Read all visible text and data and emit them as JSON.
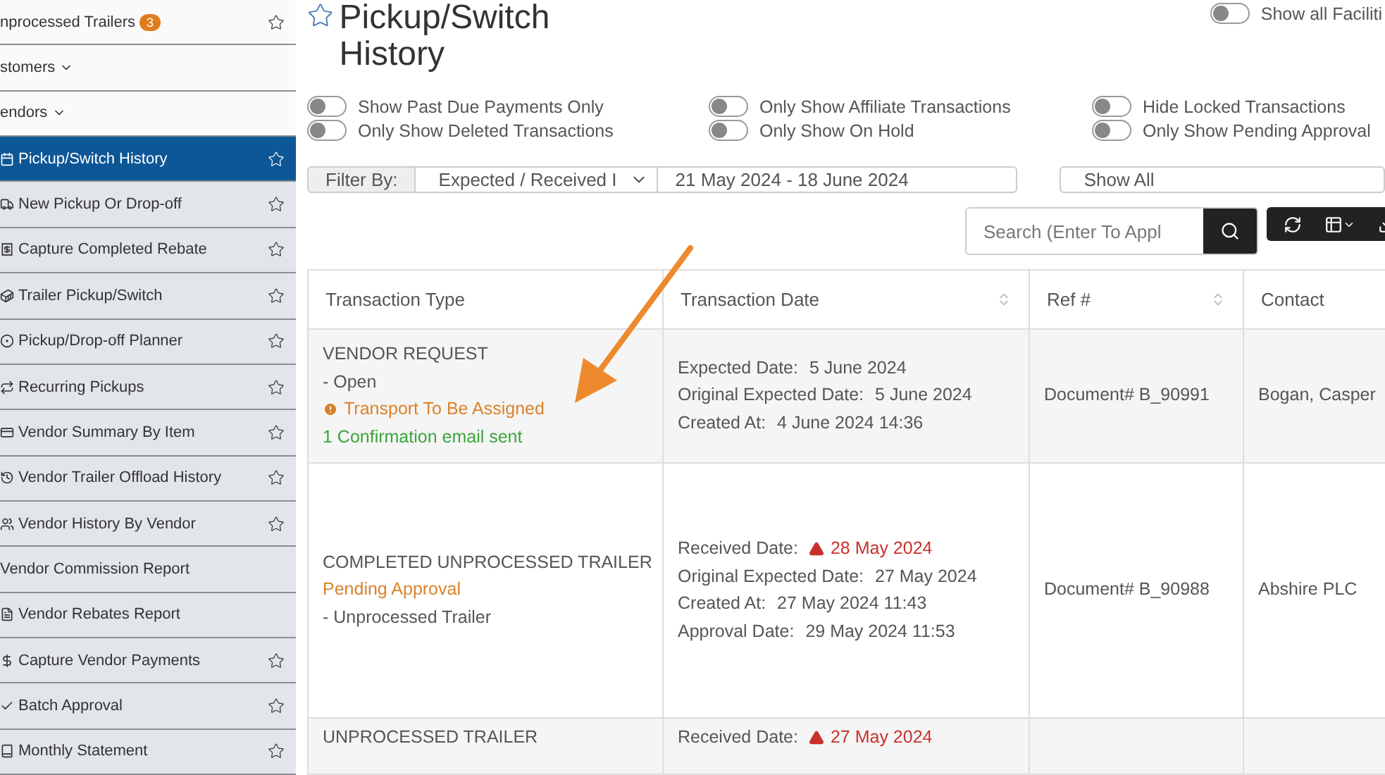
{
  "sidebar": {
    "items": [
      {
        "label": "nprocessed Trailers",
        "badge": "3",
        "kind": "link",
        "starred": true,
        "selected": false
      },
      {
        "label": "stomers",
        "kind": "dropdown",
        "starred": false,
        "selected": false
      },
      {
        "label": "endors",
        "kind": "dropdown",
        "starred": false,
        "selected": false
      },
      {
        "label": "Pickup/Switch History",
        "kind": "subitem",
        "starred": true,
        "selected": true
      },
      {
        "label": "New Pickup Or Drop-off",
        "kind": "subitem",
        "starred": true,
        "selected": false
      },
      {
        "label": "Capture Completed Rebate",
        "kind": "subitem",
        "starred": true,
        "selected": false
      },
      {
        "label": "Trailer Pickup/Switch",
        "kind": "subitem",
        "starred": true,
        "selected": false
      },
      {
        "label": "Pickup/Drop-off Planner",
        "kind": "subitem",
        "starred": true,
        "selected": false
      },
      {
        "label": "Recurring Pickups",
        "kind": "subitem",
        "starred": true,
        "selected": false
      },
      {
        "label": "Vendor Summary By Item",
        "kind": "subitem",
        "starred": true,
        "selected": false
      },
      {
        "label": "Vendor Trailer Offload History",
        "kind": "subitem",
        "starred": true,
        "selected": false
      },
      {
        "label": "Vendor History By Vendor",
        "kind": "subitem",
        "starred": true,
        "selected": false
      },
      {
        "label": "Vendor Commission Report",
        "kind": "subitem",
        "starred": false,
        "selected": false
      },
      {
        "label": "Vendor Rebates Report",
        "kind": "subitem",
        "starred": false,
        "selected": false
      },
      {
        "label": "Capture Vendor Payments",
        "kind": "subitem",
        "starred": true,
        "selected": false
      },
      {
        "label": "Batch Approval",
        "kind": "subitem",
        "starred": true,
        "selected": false
      },
      {
        "label": "Monthly Statement",
        "kind": "subitem",
        "starred": true,
        "selected": false
      }
    ]
  },
  "page": {
    "title": "Pickup/Switch History",
    "starred": false
  },
  "facility_toggle": {
    "label": "Show all Faciliti",
    "on": false
  },
  "toggles": [
    {
      "label": "Show Past Due Payments Only",
      "on": false
    },
    {
      "label": "Only Show Deleted Transactions",
      "on": false
    },
    {
      "label": "Only Show Affiliate Transactions",
      "on": false
    },
    {
      "label": "Only Show On Hold",
      "on": false
    },
    {
      "label": "Hide Locked Transactions",
      "on": false
    },
    {
      "label": "Only Show Pending Approval",
      "on": false
    }
  ],
  "filter": {
    "label": "Filter By:",
    "date_type": "Expected / Received I",
    "date_range": "21 May 2024 - 18 June 2024",
    "status": "Show All"
  },
  "search": {
    "placeholder": "Search (Enter To Appl"
  },
  "table": {
    "columns": [
      {
        "label": "Transaction Type",
        "sortable": false
      },
      {
        "label": "Transaction Date",
        "sortable": true
      },
      {
        "label": "Ref #",
        "sortable": true
      },
      {
        "label": "Contact",
        "sortable": false
      }
    ],
    "rows": [
      {
        "type_lines": [
          {
            "kind": "plain",
            "text": "VENDOR REQUEST"
          },
          {
            "kind": "plain",
            "text": "- Open"
          },
          {
            "kind": "warning",
            "text": "Transport To Be Assigned"
          },
          {
            "kind": "success",
            "text": "1 Confirmation email sent"
          }
        ],
        "date_lines": [
          {
            "label": "Expected Date:",
            "value": "5 June 2024",
            "alert": false
          },
          {
            "label": "Original Expected Date:",
            "value": "5 June 2024",
            "alert": false
          },
          {
            "label": "Created At:",
            "value": "4 June 2024 14:36",
            "alert": false
          }
        ],
        "ref": "Document# B_90991",
        "contact": "Bogan, Casper"
      },
      {
        "type_lines": [
          {
            "kind": "plain",
            "text": "COMPLETED UNPROCESSED TRAILER"
          },
          {
            "kind": "pending",
            "text": "Pending Approval"
          },
          {
            "kind": "plain",
            "text": "- Unprocessed Trailer"
          }
        ],
        "date_lines": [
          {
            "label": "Received Date:",
            "value": "28 May 2024",
            "alert": true
          },
          {
            "label": "Original Expected Date:",
            "value": "27 May 2024",
            "alert": false
          },
          {
            "label": "Created At:",
            "value": "27 May 2024 11:43",
            "alert": false
          },
          {
            "label": "Approval Date:",
            "value": "29 May 2024 11:53",
            "alert": false
          }
        ],
        "ref": "Document# B_90988",
        "contact": "Abshire PLC"
      },
      {
        "type_lines": [
          {
            "kind": "plain",
            "text": "UNPROCESSED TRAILER"
          }
        ],
        "date_lines": [
          {
            "label": "Received Date:",
            "value": "27 May 2024",
            "alert": true
          }
        ]
      }
    ]
  }
}
